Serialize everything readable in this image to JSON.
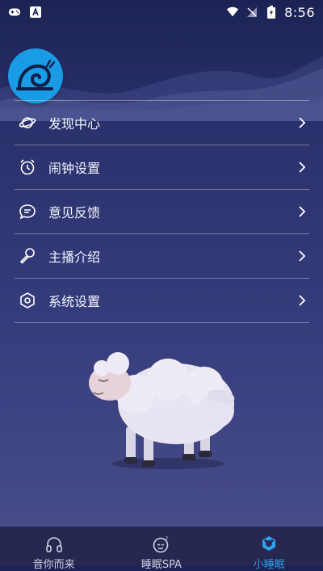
{
  "status": {
    "time": "8:56"
  },
  "menu": {
    "items": [
      {
        "label": "发现中心",
        "icon": "planet-icon"
      },
      {
        "label": "闹钟设置",
        "icon": "alarm-clock-icon"
      },
      {
        "label": "意见反馈",
        "icon": "chat-bubble-icon"
      },
      {
        "label": "主播介绍",
        "icon": "microphone-icon"
      },
      {
        "label": "系统设置",
        "icon": "settings-hexagon-icon"
      }
    ]
  },
  "tabs": [
    {
      "label": "音你而来",
      "icon": "headphones-icon",
      "active": false
    },
    {
      "label": "睡眠SPA",
      "icon": "sleepy-face-icon",
      "active": false
    },
    {
      "label": "小睡眠",
      "icon": "sheep-badge-icon",
      "active": true
    }
  ],
  "colors": {
    "accent": "#2ea0f0",
    "logo": "#1a9be6"
  }
}
